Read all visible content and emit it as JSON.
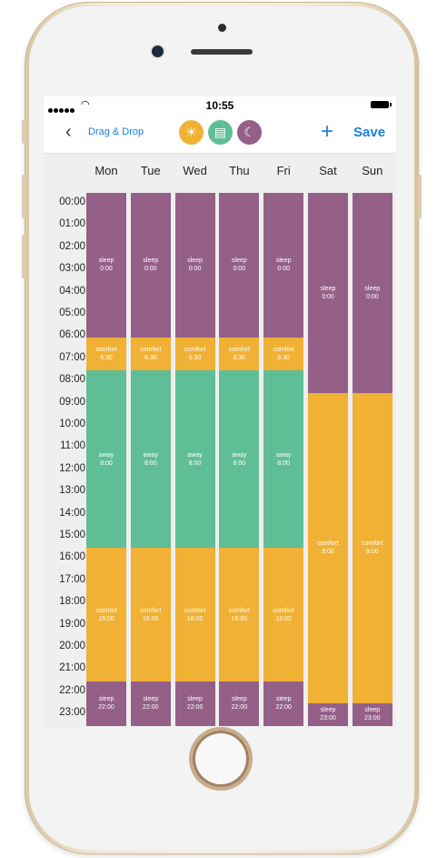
{
  "status": {
    "time": "10:55"
  },
  "nav": {
    "back_label": "Drag & Drop",
    "save_label": "Save",
    "add_label": "+"
  },
  "modes": [
    {
      "name": "comfort",
      "icon": "sun-icon",
      "color": "#f0b135"
    },
    {
      "name": "away",
      "icon": "briefcase-icon",
      "color": "#5fbe95"
    },
    {
      "name": "sleep",
      "icon": "moon-icon",
      "color": "#946088"
    }
  ],
  "hours": [
    "00:00",
    "01:00",
    "02:00",
    "03:00",
    "04:00",
    "05:00",
    "06:00",
    "07:00",
    "08:00",
    "09:00",
    "10:00",
    "11:00",
    "12:00",
    "13:00",
    "14:00",
    "15:00",
    "16:00",
    "17:00",
    "18:00",
    "19:00",
    "20:00",
    "21:00",
    "22:00",
    "23:00"
  ],
  "days": [
    {
      "name": "Mon",
      "segments": [
        {
          "mode": "sleep",
          "start": "0:00"
        },
        {
          "mode": "comfort",
          "start": "6:30"
        },
        {
          "mode": "away",
          "start": "8:00"
        },
        {
          "mode": "comfort",
          "start": "16:00"
        },
        {
          "mode": "sleep",
          "start": "22:00"
        }
      ]
    },
    {
      "name": "Tue",
      "segments": [
        {
          "mode": "sleep",
          "start": "0:00"
        },
        {
          "mode": "comfort",
          "start": "6:30"
        },
        {
          "mode": "away",
          "start": "8:00"
        },
        {
          "mode": "comfort",
          "start": "16:00"
        },
        {
          "mode": "sleep",
          "start": "22:00"
        }
      ]
    },
    {
      "name": "Wed",
      "segments": [
        {
          "mode": "sleep",
          "start": "0:00"
        },
        {
          "mode": "comfort",
          "start": "6:30"
        },
        {
          "mode": "away",
          "start": "8:00"
        },
        {
          "mode": "comfort",
          "start": "16:00"
        },
        {
          "mode": "sleep",
          "start": "22:00"
        }
      ]
    },
    {
      "name": "Thu",
      "segments": [
        {
          "mode": "sleep",
          "start": "0:00"
        },
        {
          "mode": "comfort",
          "start": "6:30"
        },
        {
          "mode": "away",
          "start": "8:00"
        },
        {
          "mode": "comfort",
          "start": "16:00"
        },
        {
          "mode": "sleep",
          "start": "22:00"
        }
      ]
    },
    {
      "name": "Fri",
      "segments": [
        {
          "mode": "sleep",
          "start": "0:00"
        },
        {
          "mode": "comfort",
          "start": "6:30"
        },
        {
          "mode": "away",
          "start": "8:00"
        },
        {
          "mode": "comfort",
          "start": "16:00"
        },
        {
          "mode": "sleep",
          "start": "22:00"
        }
      ]
    },
    {
      "name": "Sat",
      "segments": [
        {
          "mode": "sleep",
          "start": "0:00"
        },
        {
          "mode": "comfort",
          "start": "9:00"
        },
        {
          "mode": "sleep",
          "start": "23:00"
        }
      ]
    },
    {
      "name": "Sun",
      "segments": [
        {
          "mode": "sleep",
          "start": "0:00"
        },
        {
          "mode": "comfort",
          "start": "9:00"
        },
        {
          "mode": "sleep",
          "start": "23:00"
        }
      ]
    }
  ]
}
